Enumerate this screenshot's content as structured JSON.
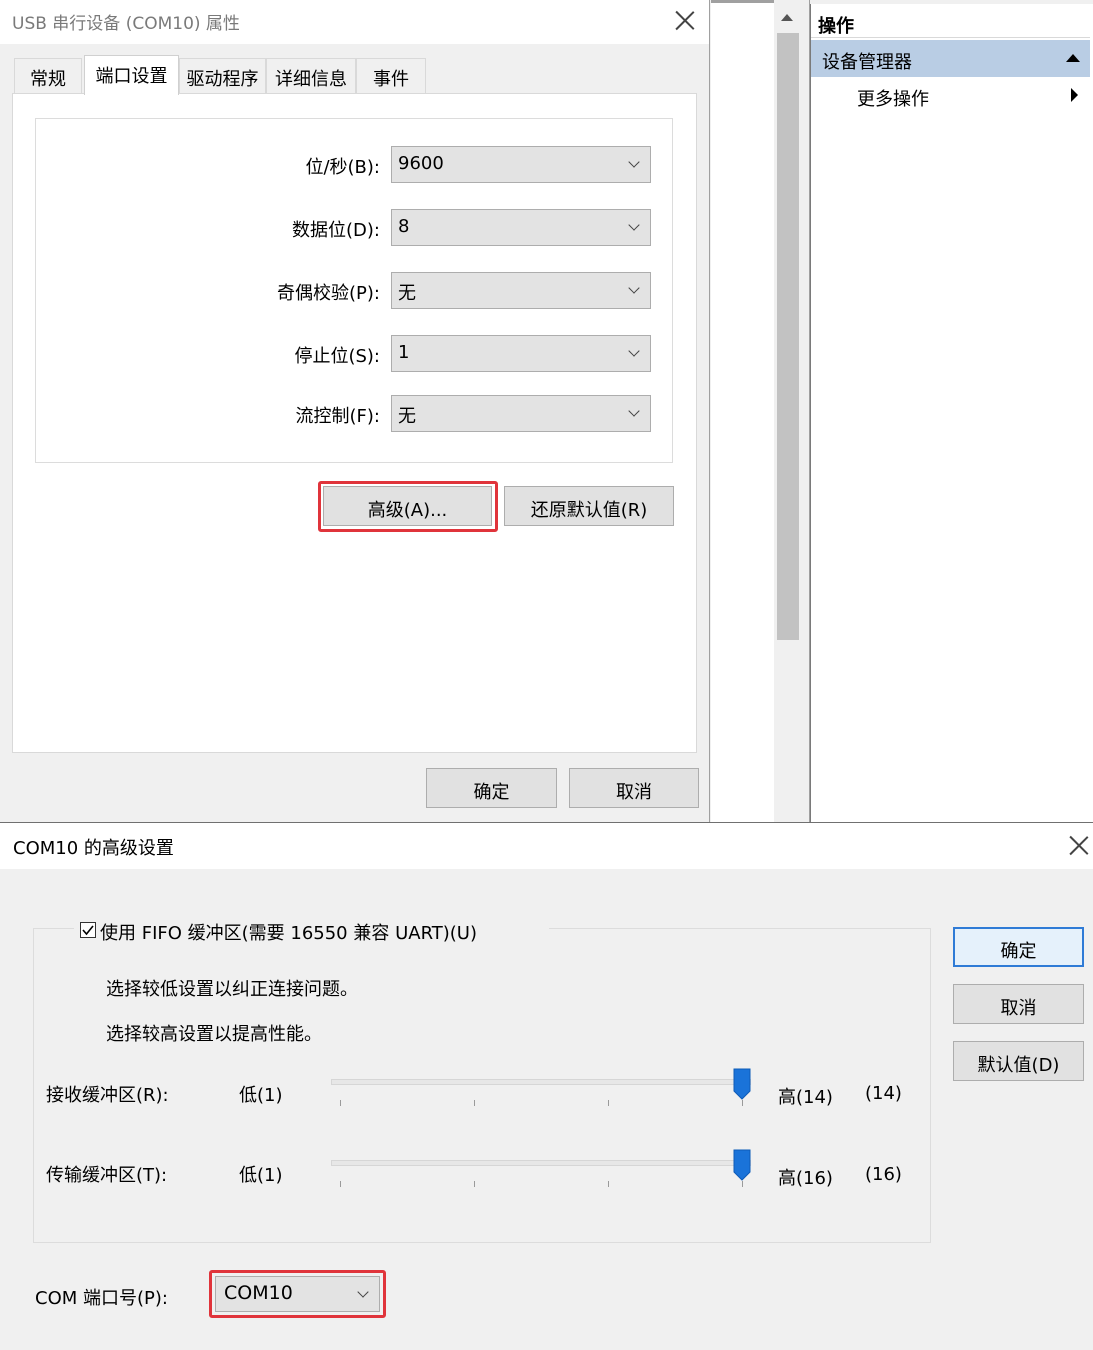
{
  "properties_dialog": {
    "title": "USB 串行设备 (COM10) 属性",
    "tabs": [
      "常规",
      "端口设置",
      "驱动程序",
      "详细信息",
      "事件"
    ],
    "active_tab": "端口设置",
    "fields": [
      {
        "label": "位/秒(B):",
        "value": "9600"
      },
      {
        "label": "数据位(D):",
        "value": "8"
      },
      {
        "label": "奇偶校验(P):",
        "value": "无"
      },
      {
        "label": "停止位(S):",
        "value": "1"
      },
      {
        "label": "流控制(F):",
        "value": "无"
      }
    ],
    "advanced_button": "高级(A)...",
    "restore_defaults_button": "还原默认值(R)",
    "ok_button": "确定",
    "cancel_button": "取消"
  },
  "mmc": {
    "actions_header": "操作",
    "section_title": "设备管理器",
    "more_actions": "更多操作"
  },
  "advanced_dialog": {
    "title": "COM10 的高级设置",
    "fifo_checkbox_label": "使用 FIFO 缓冲区(需要 16550 兼容 UART)(U)",
    "fifo_checked": true,
    "hint_low": "选择较低设置以纠正连接问题。",
    "hint_high": "选择较高设置以提高性能。",
    "receive_buffer": {
      "label": "接收缓冲区(R):",
      "low_label": "低(1)",
      "high_label": "高(14)",
      "value_label": "(14)",
      "level": 1.0
    },
    "transmit_buffer": {
      "label": "传输缓冲区(T):",
      "low_label": "低(1)",
      "high_label": "高(16)",
      "value_label": "(16)",
      "level": 1.0
    },
    "com_port_label": "COM 端口号(P):",
    "com_port_value": "COM10",
    "ok_button": "确定",
    "cancel_button": "取消",
    "defaults_button": "默认值(D)"
  },
  "colors": {
    "highlight_border": "#e0343b",
    "slider_thumb": "#1a73d9",
    "selected_section": "#b9cde4",
    "default_button_border": "#2f7bd6"
  }
}
